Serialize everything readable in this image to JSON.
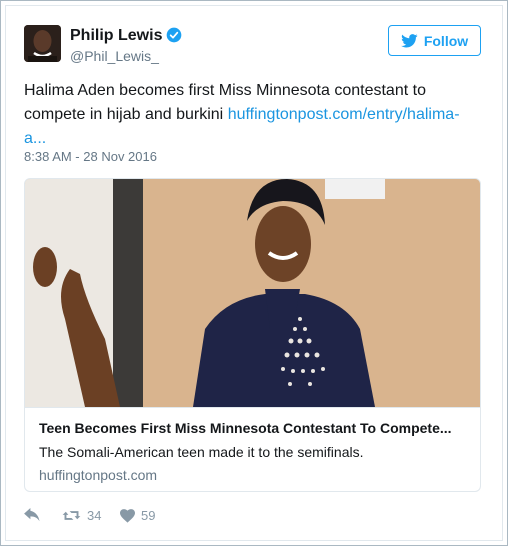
{
  "user": {
    "name": "Philip Lewis",
    "handle": "@Phil_Lewis_"
  },
  "follow_label": "Follow",
  "tweet": {
    "text": "Halima Aden becomes first Miss Minnesota contestant to compete in hijab and burkini ",
    "link": "huffingtonpost.com/entry/halima-a...",
    "timestamp": "8:38 AM - 28 Nov 2016"
  },
  "card": {
    "title": "Teen Becomes First Miss Minnesota Contestant To Compete...",
    "description": "The Somali-American teen made it to the semifinals.",
    "domain": "huffingtonpost.com"
  },
  "actions": {
    "retweets": "34",
    "likes": "59"
  },
  "colors": {
    "accent": "#1da1f2",
    "link": "#1b95e0",
    "muted": "#657786"
  }
}
